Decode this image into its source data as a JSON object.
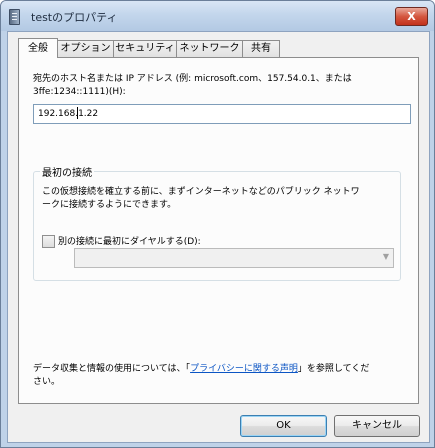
{
  "window": {
    "title": "testのプロパティ",
    "close_glyph": "X"
  },
  "tabs": [
    {
      "label": "全般",
      "active": true
    },
    {
      "label": "オプション",
      "active": false
    },
    {
      "label": "セキュリティ",
      "active": false
    },
    {
      "label": "ネットワーク",
      "active": false
    },
    {
      "label": "共有",
      "active": false
    }
  ],
  "general": {
    "host_label_line1": "宛先のホスト名または IP アドレス (例: microsoft.com、157.54.0.1、または",
    "host_label_line2": "3ffe:1234::1111)(H):",
    "host_value": "192.168.1.22",
    "first_connection": {
      "title": "最初の接続",
      "desc_line1": "この仮想接続を確立する前に、まずインターネットなどのパブリック ネットワ",
      "desc_line2": "ークに接続するようにできます。",
      "dial_checkbox_label": "別の接続に最初にダイヤルする(D):",
      "dial_checked": false
    },
    "privacy_prefix": "データ収集と情報の使用については、「",
    "privacy_link": "プライバシーに関する声明",
    "privacy_suffix": "」を参照してくだ",
    "privacy_line2": "さい。"
  },
  "buttons": {
    "ok": "OK",
    "cancel": "キャンセル"
  }
}
